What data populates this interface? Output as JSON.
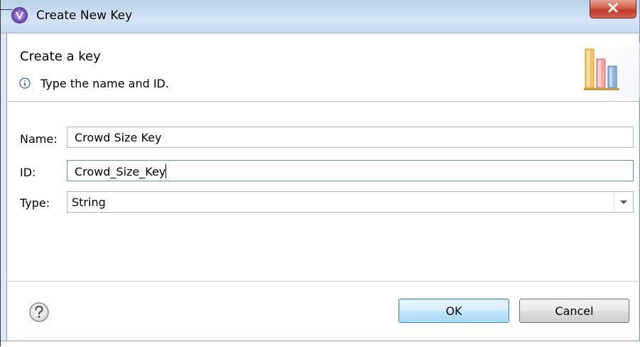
{
  "window": {
    "title": "Create New Key",
    "close_label": "X"
  },
  "header": {
    "title": "Create a key",
    "description": "Type the name and ID."
  },
  "form": {
    "name_label": "Name:",
    "name_value": "Crowd Size Key",
    "id_label": "ID:",
    "id_value": "Crowd_Size_Key",
    "type_label": "Type:",
    "type_value": "String"
  },
  "buttons": {
    "ok_label": "OK",
    "cancel_label": "Cancel"
  },
  "icons": {
    "app": "app-icon",
    "info": "info-icon",
    "help": "help-icon",
    "header_graphic": "bar-chart-icon",
    "dropdown": "chevron-down-icon"
  },
  "colors": {
    "title_bar": "#c9dcf0",
    "close_button": "#c0392b",
    "ok_button": "#bee6fd",
    "focus_border": "#5b8fd4"
  }
}
